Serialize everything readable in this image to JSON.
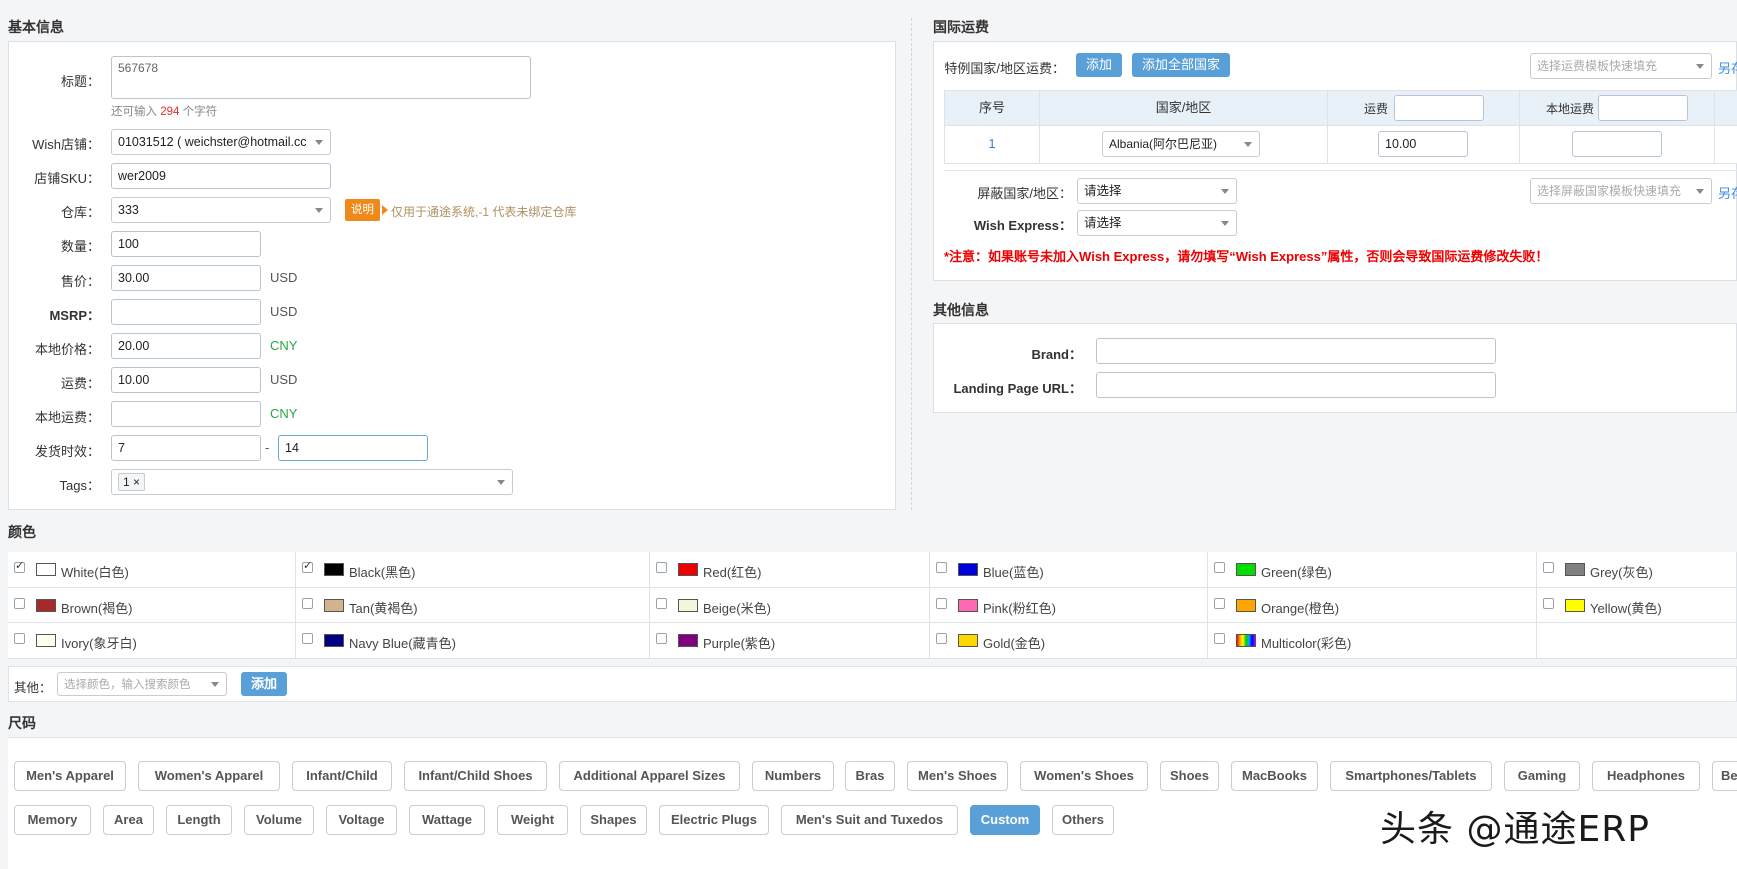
{
  "basic": {
    "section_title": "基本信息",
    "title_label": "标题：",
    "title_value": "567678",
    "remaining_prefix": "还可输入",
    "remaining_count": "294",
    "remaining_suffix": "个字符",
    "store_label": "Wish店铺：",
    "store_value": "01031512 ( weichster@hotmail.cc",
    "sku_label": "店铺SKU：",
    "sku_value": "wer2009",
    "warehouse_label": "仓库：",
    "warehouse_value": "333",
    "explain_badge": "说明",
    "warehouse_hint": "仅用于通途系统,-1 代表未绑定仓库",
    "qty_label": "数量：",
    "qty_value": "100",
    "price_label": "售价：",
    "price_value": "30.00",
    "price_unit": "USD",
    "msrp_label": "MSRP：",
    "msrp_value": "",
    "msrp_unit": "USD",
    "local_price_label": "本地价格：",
    "local_price_value": "20.00",
    "local_price_unit": "CNY",
    "shipping_label": "运费：",
    "shipping_value": "10.00",
    "shipping_unit": "USD",
    "local_shipping_label": "本地运费：",
    "local_shipping_value": "",
    "local_shipping_unit": "CNY",
    "delivery_label": "发货时效：",
    "delivery_min": "7",
    "delivery_sep": "-",
    "delivery_max": "14",
    "tags_label": "Tags：",
    "tag_chip": "1",
    "tag_remove": "×"
  },
  "intl": {
    "section_title": "国际运费",
    "special_label": "特例国家/地区运费：",
    "add_btn": "添加",
    "add_all_btn": "添加全部国家",
    "template_placeholder": "选择运费模板快速填充",
    "save_as": "另存",
    "table": {
      "col_no": "序号",
      "col_country": "国家/地区",
      "col_fee": "运费",
      "col_local_fee": "本地运费",
      "row_no": "1",
      "row_country": "Albania(阿尔巴尼亚)",
      "row_fee": "10.00",
      "row_local_fee": ""
    },
    "block_label": "屏蔽国家/地区：",
    "block_value": "请选择",
    "block_template_placeholder": "选择屏蔽国家模板快速填充",
    "block_save_as": "另存",
    "express_label": "Wish Express：",
    "express_value": "请选择",
    "warning": "*注意：如果账号未加入Wish Express，请勿填写“Wish Express”属性，否则会导致国际运费修改失败！"
  },
  "other": {
    "section_title": "其他信息",
    "brand_label": "Brand：",
    "brand_value": "",
    "url_label": "Landing Page URL：",
    "url_value": ""
  },
  "colors": {
    "section_title": "颜色",
    "items": [
      {
        "label": "White(白色)",
        "hex": "#ffffff",
        "checked": true
      },
      {
        "label": "Black(黑色)",
        "hex": "#000000",
        "checked": true
      },
      {
        "label": "Red(红色)",
        "hex": "#ee0000",
        "checked": false
      },
      {
        "label": "Blue(蓝色)",
        "hex": "#0000dd",
        "checked": false
      },
      {
        "label": "Green(绿色)",
        "hex": "#00dd00",
        "checked": false
      },
      {
        "label": "Grey(灰色)",
        "hex": "#808080",
        "checked": false
      },
      {
        "label": "Brown(褐色)",
        "hex": "#a52a2a",
        "checked": false
      },
      {
        "label": "Tan(黄褐色)",
        "hex": "#d2b48c",
        "checked": false
      },
      {
        "label": "Beige(米色)",
        "hex": "#f5f5dc",
        "checked": false
      },
      {
        "label": "Pink(粉红色)",
        "hex": "#ff69b4",
        "checked": false
      },
      {
        "label": "Orange(橙色)",
        "hex": "#ffa500",
        "checked": false
      },
      {
        "label": "Yellow(黄色)",
        "hex": "#ffff00",
        "checked": false
      },
      {
        "label": "Ivory(象牙白)",
        "hex": "#fffff0",
        "checked": false
      },
      {
        "label": "Navy Blue(藏青色)",
        "hex": "#000080",
        "checked": false
      },
      {
        "label": "Purple(紫色)",
        "hex": "#800080",
        "checked": false
      },
      {
        "label": "Gold(金色)",
        "hex": "#ffd700",
        "checked": false
      },
      {
        "label": "Multicolor(彩色)",
        "hex": "rainbow",
        "checked": false
      }
    ],
    "other_label": "其他：",
    "other_placeholder": "选择颜色，输入搜索颜色",
    "add_btn": "添加"
  },
  "sizes": {
    "section_title": "尺码",
    "row1": [
      "Men's Apparel",
      "Women's Apparel",
      "Infant/Child",
      "Infant/Child Shoes",
      "Additional Apparel Sizes",
      "Numbers",
      "Bras",
      "Men's Shoes",
      "Women's Shoes",
      "Shoes",
      "MacBooks",
      "Smartphones/Tablets",
      "Gaming",
      "Headphones",
      "Bed"
    ],
    "row2": [
      "Memory",
      "Area",
      "Length",
      "Volume",
      "Voltage",
      "Wattage",
      "Weight",
      "Shapes",
      "Electric Plugs",
      "Men's Suit and Tuxedos",
      "Custom",
      "Others"
    ],
    "active": "Custom"
  },
  "watermark": "头条 @通途ERP"
}
